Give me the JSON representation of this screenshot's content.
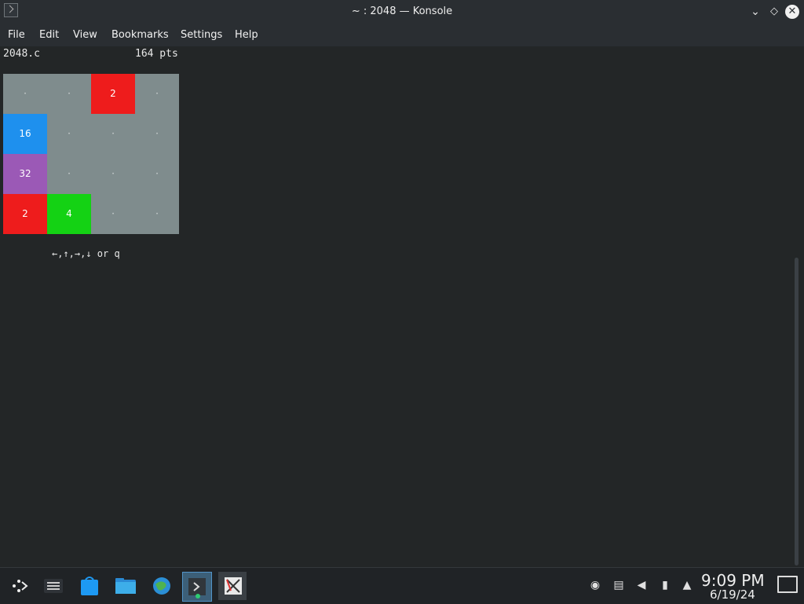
{
  "window": {
    "title": "~ : 2048 — Konsole"
  },
  "menu": [
    "File",
    "Edit",
    "View",
    "Bookmarks",
    "Settings",
    "Help"
  ],
  "terminal": {
    "filename": "2048.c",
    "score": "164 pts",
    "controls": "←,↑,→,↓ or q",
    "board": [
      [
        "·",
        "·",
        "2",
        "·"
      ],
      [
        "16",
        "·",
        "·",
        "·"
      ],
      [
        "32",
        "·",
        "·",
        "·"
      ],
      [
        "2",
        "4",
        "·",
        "·"
      ]
    ],
    "colors": {
      "2": "#ee1c1c",
      "4": "#14d214",
      "16": "#1e90ee",
      "32": "#9b59b6",
      "empty": "#7f8c8d"
    }
  },
  "taskbar": {
    "apps": [
      "app-launcher-icon",
      "system-settings-icon",
      "discover-store-icon",
      "file-manager-icon",
      "browser-icon",
      "konsole-icon",
      "xterm-icon"
    ],
    "clock": "9:09 PM",
    "date": "6/19/24"
  }
}
